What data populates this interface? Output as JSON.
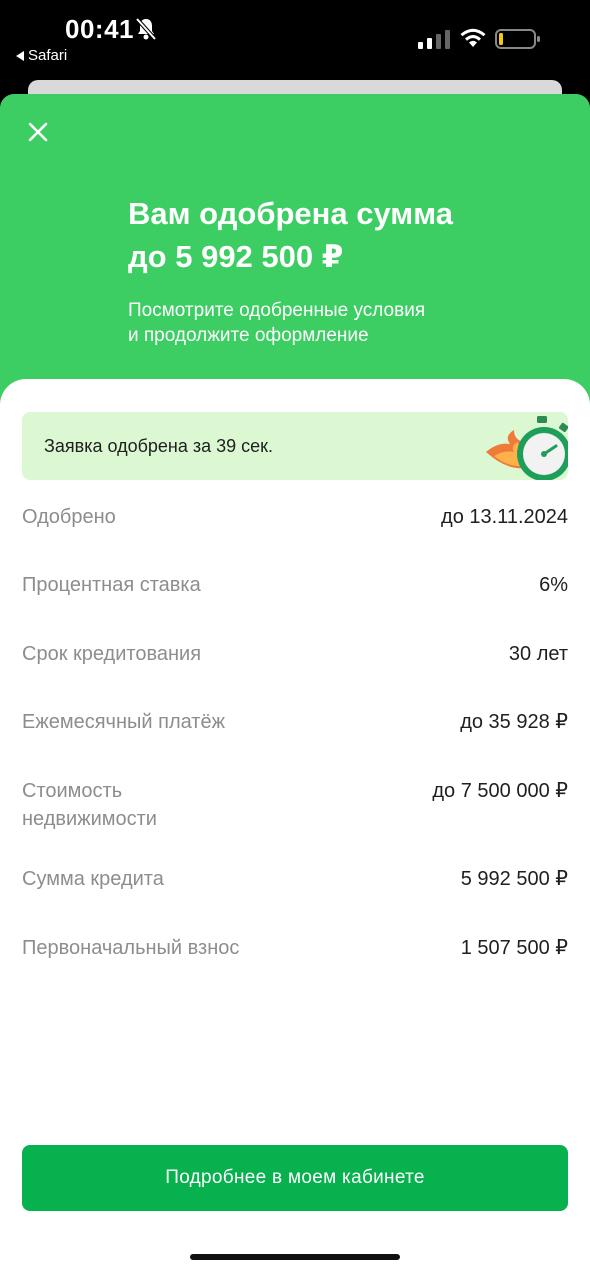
{
  "status_bar": {
    "time": "00:41",
    "back_app": "Safari"
  },
  "hero": {
    "title_line1": "Вам одобрена сумма",
    "title_line2": "до 5 992 500 ₽",
    "subtitle_line1": "Посмотрите одобренные условия",
    "subtitle_line2": "и продолжите оформление"
  },
  "banner": {
    "text": "Заявка одобрена за 39 сек."
  },
  "details": [
    {
      "label": "Одобрено",
      "value": "до 13.11.2024"
    },
    {
      "label": "Процентная ставка",
      "value": "6%"
    },
    {
      "label": "Срок кредитования",
      "value": "30 лет"
    },
    {
      "label": "Ежемесячный платёж",
      "value": "до 35 928 ₽"
    },
    {
      "label": "Стоимость недвижимости",
      "value": "до 7 500 000 ₽"
    },
    {
      "label": "Сумма кредита",
      "value": "5 992 500 ₽"
    },
    {
      "label": "Первоначальный взнос",
      "value": "1 507 500 ₽"
    }
  ],
  "cta": {
    "label": "Подробнее в моем кабинете"
  },
  "colors": {
    "brand_green": "#3ccd63",
    "button_green": "#07b14e",
    "banner_bg": "#dcf8d2"
  },
  "icons": {
    "close": "close-icon",
    "stopwatch": "stopwatch-icon",
    "bell_muted": "bell-slash-icon"
  }
}
